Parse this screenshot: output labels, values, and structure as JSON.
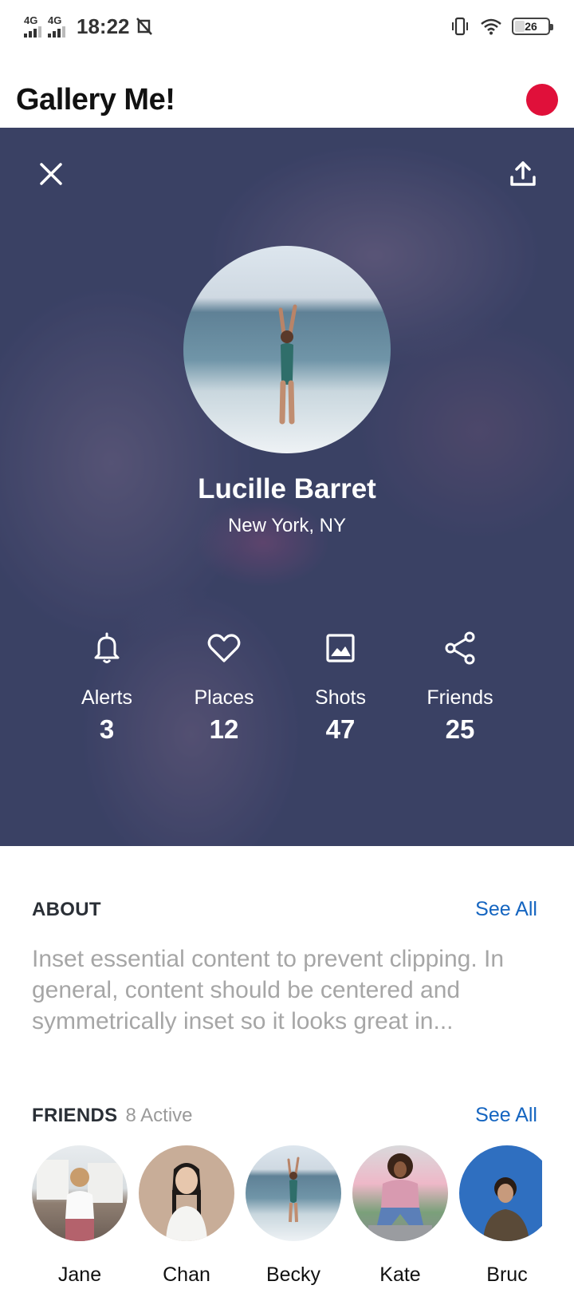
{
  "status_bar": {
    "network_1": "4G",
    "network_2": "4G",
    "time": "18:22",
    "battery": "26"
  },
  "header": {
    "title": "Gallery Me!",
    "record_color": "#e0103a"
  },
  "profile": {
    "name": "Lucille Barret",
    "location": "New York, NY"
  },
  "stats": [
    {
      "icon": "bell-icon",
      "label": "Alerts",
      "value": "3"
    },
    {
      "icon": "heart-icon",
      "label": "Places",
      "value": "12"
    },
    {
      "icon": "image-icon",
      "label": "Shots",
      "value": "47"
    },
    {
      "icon": "share-icon",
      "label": "Friends",
      "value": "25"
    }
  ],
  "about": {
    "title": "ABOUT",
    "see_all": "See All",
    "text": "Inset essential content to prevent clipping. In general, content should be centered and symmetrically inset so it looks great in..."
  },
  "friends": {
    "title": "FRIENDS",
    "active": "8 Active",
    "see_all": "See All",
    "items": [
      {
        "name": "Jane"
      },
      {
        "name": "Chan"
      },
      {
        "name": "Becky"
      },
      {
        "name": "Kate"
      },
      {
        "name": "Bruc"
      }
    ]
  },
  "colors": {
    "accent": "#1565c0",
    "hero": "#3f4568"
  }
}
